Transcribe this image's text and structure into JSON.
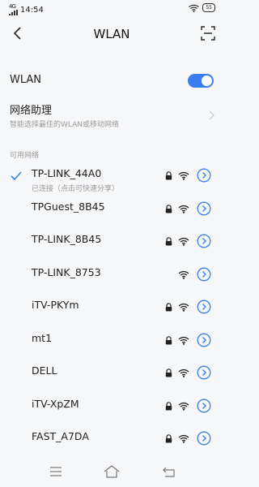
{
  "status": {
    "network": "4G",
    "time": "14:54",
    "battery": "55"
  },
  "header": {
    "title": "WLAN"
  },
  "wlan": {
    "label": "WLAN",
    "enabled": true
  },
  "assistant": {
    "title": "网络助理",
    "subtitle": "智能选择最佳的WLAN或移动网络"
  },
  "section": {
    "label": "可用网络"
  },
  "networks": [
    {
      "name": "TP-LINK_44A0",
      "subtitle": "已连接（点击可快速分享）",
      "connected": true,
      "secured": true
    },
    {
      "name": "TPGuest_8B45",
      "subtitle": "",
      "connected": false,
      "secured": true
    },
    {
      "name": "TP-LINK_8B45",
      "subtitle": "",
      "connected": false,
      "secured": true
    },
    {
      "name": "TP-LINK_8753",
      "subtitle": "",
      "connected": false,
      "secured": false
    },
    {
      "name": "iTV-PKYm",
      "subtitle": "",
      "connected": false,
      "secured": true
    },
    {
      "name": "mt1",
      "subtitle": "",
      "connected": false,
      "secured": true
    },
    {
      "name": "DELL",
      "subtitle": "",
      "connected": false,
      "secured": true
    },
    {
      "name": "iTV-XpZM",
      "subtitle": "",
      "connected": false,
      "secured": true
    },
    {
      "name": "FAST_A7DA",
      "subtitle": "",
      "connected": false,
      "secured": true
    }
  ],
  "colors": {
    "accent": "#3a7df0",
    "background": "#f6f7f9",
    "muted": "#9a9a9a"
  }
}
